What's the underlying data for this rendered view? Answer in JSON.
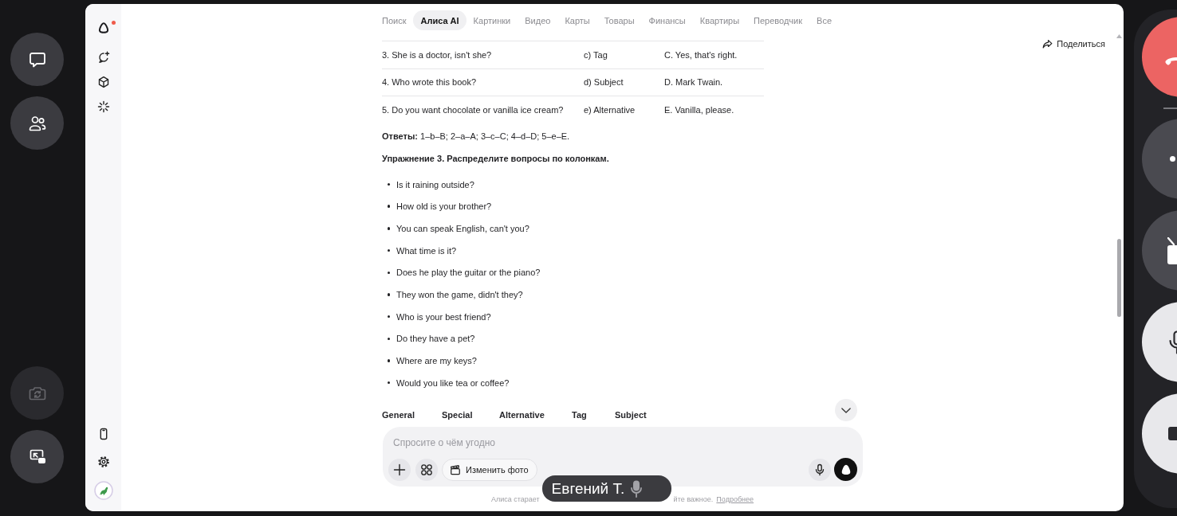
{
  "call_panel_left": {
    "buttons": [
      {
        "disabled": false
      },
      {
        "disabled": false
      },
      {
        "disabled": true
      },
      {
        "disabled": false
      }
    ]
  },
  "sidebar": {
    "unread": true
  },
  "nav_tabs": [
    {
      "label": "Поиск",
      "selected": false
    },
    {
      "label": "Алиса AI",
      "selected": true
    },
    {
      "label": "Картинки",
      "selected": false
    },
    {
      "label": "Видео",
      "selected": false
    },
    {
      "label": "Карты",
      "selected": false
    },
    {
      "label": "Товары",
      "selected": false
    },
    {
      "label": "Финансы",
      "selected": false
    },
    {
      "label": "Квартиры",
      "selected": false
    },
    {
      "label": "Переводчик",
      "selected": false
    },
    {
      "label": "Все",
      "selected": false
    }
  ],
  "share_button": {
    "label": "Поделиться"
  },
  "answer_table": {
    "rows": [
      [
        "3. She is a doctor, isn't she?",
        "c) Tag",
        "C. Yes, that's right."
      ],
      [
        "4. Who wrote this book?",
        "d) Subject",
        "D. Mark Twain."
      ],
      [
        "5. Do you want chocolate or vanilla ice cream?",
        "e) Alternative",
        "E. Vanilla, please."
      ]
    ]
  },
  "answers": "**Ответы:** 1–b–B; 2–a–A; 3–c–C; 4–d–D; 5–e–E.",
  "exercise_title": "Упражнение 3. Распределите вопросы по колонкам.",
  "questions": [
    "Is it raining outside?",
    "How old is your brother?",
    "You can speak English, can't you?",
    "What time is it?",
    "Does he play the guitar or the piano?",
    "They won the game, didn't they?",
    "Who is your best friend?",
    "Do they have a pet?",
    "Where are my keys?",
    "Would you like tea or coffee?"
  ],
  "columns_table": {
    "columns": [
      "General",
      "Special",
      "Alternative",
      "Tag",
      "Subject"
    ]
  },
  "composer": {
    "placeholder": "Спросите о чём угодно",
    "photo_button": "Изменить фото"
  },
  "disclaimer": {
    "text_start": "Алиса старает",
    "text_end": "йте важное.",
    "link": "Подробнее"
  },
  "speaker_tag": {
    "name": "Евгений Т."
  },
  "call_panel_right": {
    "buttons": [
      {
        "kind": "hangup"
      },
      {
        "kind": "toggle",
        "on": false
      },
      {
        "kind": "toggle",
        "on": false
      },
      {
        "kind": "toggle",
        "on": true
      },
      {
        "kind": "toggle",
        "on": true
      }
    ]
  }
}
